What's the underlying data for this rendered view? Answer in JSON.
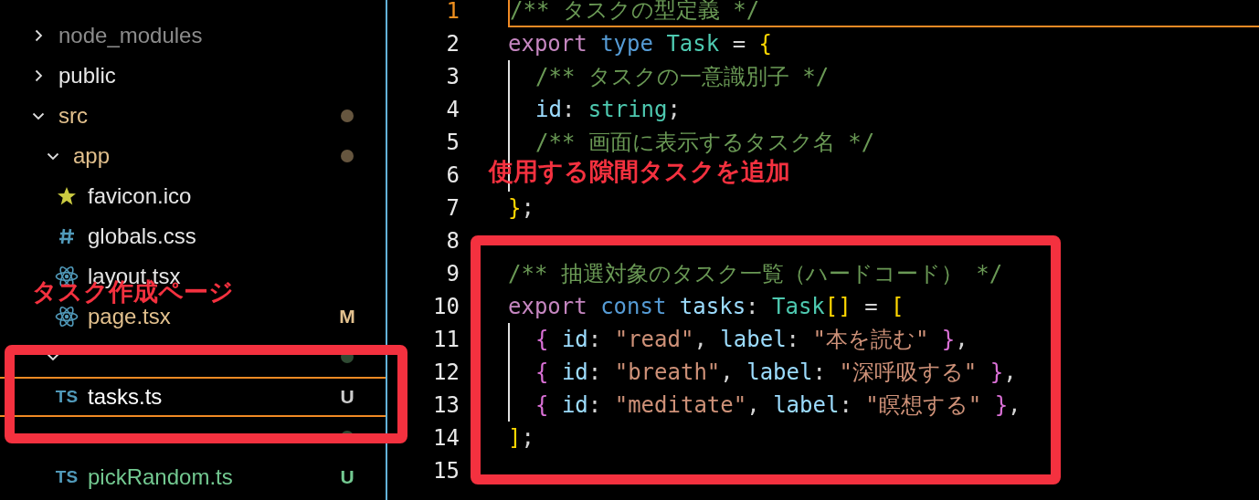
{
  "explorer": {
    "items": [
      {
        "kind": "folder",
        "label": "node_modules",
        "expanded": false,
        "color": "#8c8c8c"
      },
      {
        "kind": "folder",
        "label": "public",
        "expanded": false,
        "color": "#e6e6e6"
      },
      {
        "kind": "folder",
        "label": "src",
        "expanded": true,
        "color": "#e2c08d",
        "dot": true,
        "children": [
          {
            "kind": "folder",
            "label": "app",
            "expanded": true,
            "color": "#e2c08d",
            "dot": true,
            "children": [
              {
                "kind": "image",
                "label": "favicon.ico",
                "color": "#e6e6e6",
                "selected": false
              },
              {
                "kind": "stylesheet",
                "label": "globals.css",
                "color": "#e6e6e6",
                "selected": false
              },
              {
                "kind": "component",
                "label": "layout.tsx",
                "color": "#e6e6e6",
                "selected": false
              },
              {
                "kind": "component",
                "label": "page.tsx",
                "color": "#e2c08d",
                "badge": "M",
                "selected": false
              }
            ]
          },
          {
            "kind": "folder",
            "expanded": true,
            "color": "#2f4a33",
            "dot": true,
            "children": [
              {
                "kind": "script",
                "icon_text": "TS",
                "label": "tasks.ts",
                "color": "#ffffff",
                "badge": "U",
                "selected": true
              }
            ]
          },
          {
            "kind": "folder",
            "color": "#2f4a33",
            "dot": true,
            "children": [
              {
                "kind": "script",
                "icon_text": "TS",
                "label": "pickRandom.ts",
                "color": "#73c991",
                "badge": "U",
                "selected": false
              }
            ]
          }
        ]
      }
    ]
  },
  "editor": {
    "lines": [
      {
        "number": "1",
        "current": true,
        "guide": false,
        "tokens": [
          {
            "t": "/** タスクの型定義 */",
            "kind": "comment"
          }
        ]
      },
      {
        "number": "2",
        "current": false,
        "guide": false,
        "tokens": [
          {
            "t": "export ",
            "kind": "keyword"
          },
          {
            "t": "type ",
            "kind": "storage"
          },
          {
            "t": "Task",
            "kind": "type"
          },
          {
            "t": " = ",
            "kind": "punct"
          },
          {
            "t": "{",
            "kind": "bracket1"
          }
        ]
      },
      {
        "number": "3",
        "current": false,
        "guide": true,
        "tokens": [
          {
            "t": "/** タスクの一意識別子 */",
            "kind": "comment"
          }
        ]
      },
      {
        "number": "4",
        "current": false,
        "guide": true,
        "tokens": [
          {
            "t": "id",
            "kind": "prop"
          },
          {
            "t": ": ",
            "kind": "punct"
          },
          {
            "t": "string",
            "kind": "type"
          },
          {
            "t": ";",
            "kind": "punct"
          }
        ]
      },
      {
        "number": "5",
        "current": false,
        "guide": true,
        "tokens": [
          {
            "t": "/** 画面に表示するタスク名 */",
            "kind": "comment"
          }
        ]
      },
      {
        "number": "6",
        "current": false,
        "guide": true
      },
      {
        "number": "7",
        "current": false,
        "guide": false,
        "tokens": [
          {
            "t": "}",
            "kind": "bracket1"
          },
          {
            "t": ";",
            "kind": "punct"
          }
        ]
      },
      {
        "number": "8",
        "current": false,
        "guide": false
      },
      {
        "number": "9",
        "current": false,
        "guide": false,
        "tokens": [
          {
            "t": "/** 抽選対象のタスク一覧（ハードコード） */",
            "kind": "comment"
          }
        ]
      },
      {
        "number": "10",
        "current": false,
        "guide": false,
        "tokens": [
          {
            "t": "export ",
            "kind": "keyword"
          },
          {
            "t": "const ",
            "kind": "storage"
          },
          {
            "t": "tasks",
            "kind": "prop"
          },
          {
            "t": ": ",
            "kind": "punct"
          },
          {
            "t": "Task",
            "kind": "type"
          },
          {
            "t": "[]",
            "kind": "bracket1"
          },
          {
            "t": " = ",
            "kind": "punct"
          },
          {
            "t": "[",
            "kind": "bracket1"
          }
        ]
      },
      {
        "number": "11",
        "current": false,
        "guide": true,
        "tokens": [
          {
            "t": "{ ",
            "kind": "bracket2"
          },
          {
            "t": "id",
            "kind": "prop"
          },
          {
            "t": ": ",
            "kind": "punct"
          },
          {
            "t": "\"read\"",
            "kind": "string"
          },
          {
            "t": ", ",
            "kind": "punct"
          },
          {
            "t": "label",
            "kind": "prop"
          },
          {
            "t": ": ",
            "kind": "punct"
          },
          {
            "t": "\"本を読む\"",
            "kind": "string"
          },
          {
            "t": " }",
            "kind": "bracket2"
          },
          {
            "t": ",",
            "kind": "punct"
          }
        ]
      },
      {
        "number": "12",
        "current": false,
        "guide": true,
        "tokens": [
          {
            "t": "{ ",
            "kind": "bracket2"
          },
          {
            "t": "id",
            "kind": "prop"
          },
          {
            "t": ": ",
            "kind": "punct"
          },
          {
            "t": "\"breath\"",
            "kind": "string"
          },
          {
            "t": ", ",
            "kind": "punct"
          },
          {
            "t": "label",
            "kind": "prop"
          },
          {
            "t": ": ",
            "kind": "punct"
          },
          {
            "t": "\"深呼吸する\"",
            "kind": "string"
          },
          {
            "t": " }",
            "kind": "bracket2"
          },
          {
            "t": ",",
            "kind": "punct"
          }
        ]
      },
      {
        "number": "13",
        "current": false,
        "guide": true,
        "tokens": [
          {
            "t": "{ ",
            "kind": "bracket2"
          },
          {
            "t": "id",
            "kind": "prop"
          },
          {
            "t": ": ",
            "kind": "punct"
          },
          {
            "t": "\"meditate\"",
            "kind": "string"
          },
          {
            "t": ", ",
            "kind": "punct"
          },
          {
            "t": "label",
            "kind": "prop"
          },
          {
            "t": ": ",
            "kind": "punct"
          },
          {
            "t": "\"瞑想する\"",
            "kind": "string"
          },
          {
            "t": " }",
            "kind": "bracket2"
          },
          {
            "t": ",",
            "kind": "punct"
          }
        ]
      },
      {
        "number": "14",
        "current": false,
        "guide": false,
        "tokens": [
          {
            "t": "]",
            "kind": "bracket1"
          },
          {
            "t": ";",
            "kind": "punct"
          }
        ]
      },
      {
        "number": "15",
        "current": false,
        "guide": false
      }
    ]
  },
  "annotations": [
    {
      "kind": "label",
      "text": "使用する隙間タスクを追加"
    },
    {
      "kind": "label",
      "text": "タスク作成ページ"
    },
    {
      "kind": "box"
    },
    {
      "kind": "box"
    }
  ]
}
